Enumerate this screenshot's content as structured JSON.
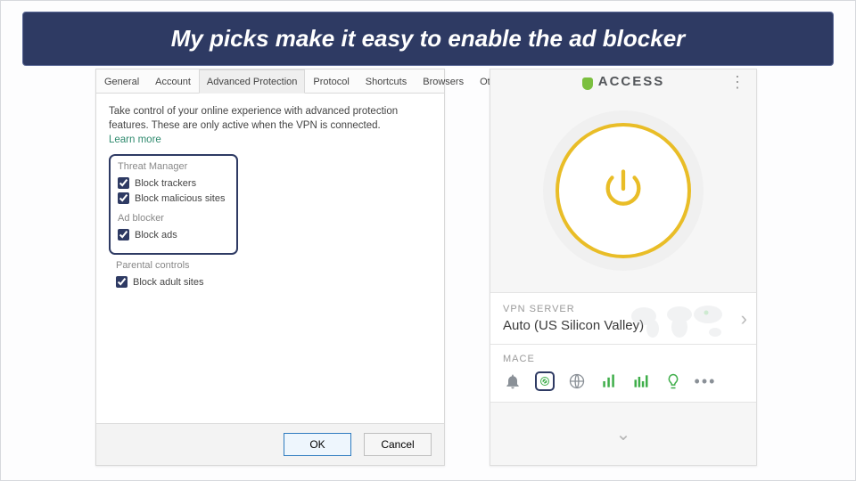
{
  "banner": {
    "text": "My picks make it easy to enable the ad blocker"
  },
  "left": {
    "tabs": [
      {
        "label": "General"
      },
      {
        "label": "Account"
      },
      {
        "label": "Advanced Protection"
      },
      {
        "label": "Protocol"
      },
      {
        "label": "Shortcuts"
      },
      {
        "label": "Browsers"
      },
      {
        "label": "Other"
      }
    ],
    "active_tab_index": 2,
    "description": "Take control of your online experience with advanced protection features. These are only active when the VPN is connected.",
    "learn_more": "Learn more",
    "groups": {
      "threat": {
        "title": "Threat Manager",
        "block_trackers": "Block trackers",
        "block_malicious": "Block malicious sites"
      },
      "adblock": {
        "title": "Ad blocker",
        "block_ads": "Block ads"
      },
      "parental": {
        "title": "Parental controls",
        "block_adult": "Block adult sites"
      }
    },
    "buttons": {
      "ok": "OK",
      "cancel": "Cancel"
    }
  },
  "right": {
    "brand": "ACCESS",
    "server": {
      "label": "VPN SERVER",
      "name": "Auto (US Silicon Valley)"
    },
    "mace": {
      "label": "MACE"
    },
    "icons": {
      "bell": "notifications-icon",
      "mace": "mace-shield-icon",
      "globe": "network-icon",
      "usage": "usage-icon",
      "perf": "performance-icon",
      "bulb": "tips-icon",
      "more": "more-icon"
    }
  }
}
